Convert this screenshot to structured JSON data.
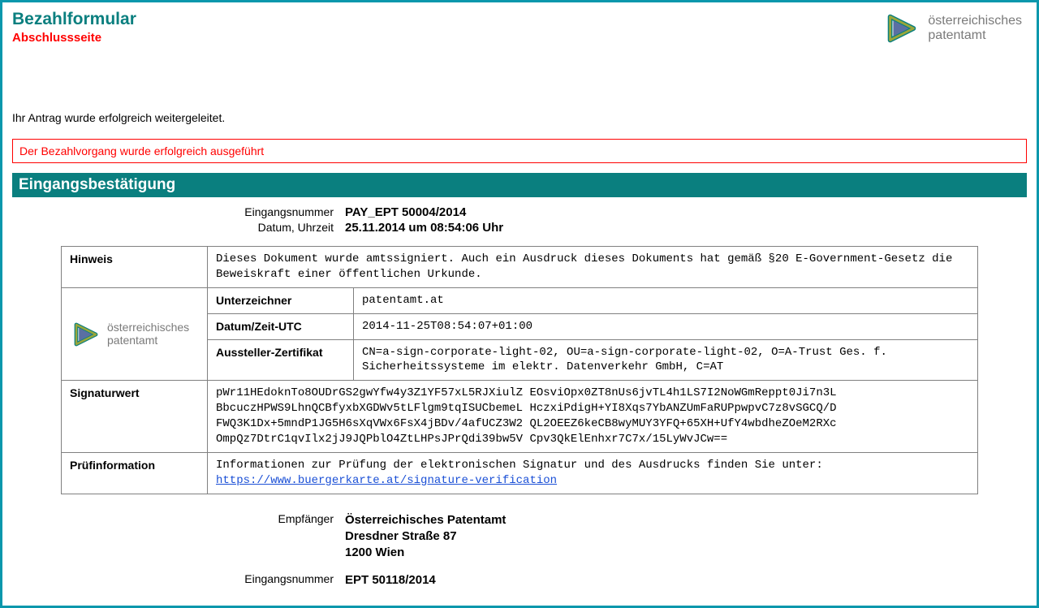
{
  "header": {
    "title": "Bezahlformular",
    "subtitle": "Abschlussseite",
    "logo_line1": "österreichisches",
    "logo_line2": "patentamt"
  },
  "forward_msg": "Ihr Antrag wurde erfolgreich weitergeleitet.",
  "pay_status": "Der Bezahlvorgang wurde erfolgreich ausgeführt",
  "confirm_section_title": "Eingangsbestätigung",
  "meta": {
    "num_label": "Eingangsnummer",
    "num_value": "PAY_EPT 50004/2014",
    "dt_label": "Datum, Uhrzeit",
    "dt_value": "25.11.2014 um 08:54:06 Uhr"
  },
  "sig": {
    "hinweis_label": "Hinweis",
    "hinweis_text": "Dieses Dokument wurde amtssigniert. Auch ein Ausdruck dieses Dokuments hat gemäß §20 E-Government-Gesetz die Beweiskraft einer öffentlichen Urkunde.",
    "small_logo_line1": "österreichisches",
    "small_logo_line2": "patentamt",
    "unterzeichner_label": "Unterzeichner",
    "unterzeichner_value": "patentamt.at",
    "datum_label": "Datum/Zeit-UTC",
    "datum_value": "2014-11-25T08:54:07+01:00",
    "aussteller_label": "Aussteller-Zertifikat",
    "aussteller_value": "CN=a-sign-corporate-light-02, OU=a-sign-corporate-light-02, O=A-Trust Ges. f. Sicherheitssysteme im elektr. Datenverkehr GmbH, C=AT",
    "signaturwert_label": "Signaturwert",
    "signaturwert_value": "pWr11HEdoknTo8OUDrGS2gwYfw4y3Z1YF57xL5RJXiulZ EOsviOpx0ZT8nUs6jvTL4h1LS7I2NoWGmReppt0Ji7n3L BbcuczHPWS9LhnQCBfyxbXGDWv5tLFlgm9tqISUCbemeL HczxiPdigH+YI8Xqs7YbANZUmFaRUPpwpvC7z8vSGCQ/D FWQ3K1Dx+5mndP1JG5H6sXqVWx6FsX4jBDv/4afUCZ3W2 QL2OEEZ6keCB8wyMUY3YFQ+65XH+UfY4wbdheZOeM2RXc OmpQz7DtrC1qvIlx2jJ9JQPblO4ZtLHPsJPrQdi39bw5V Cpv3QkElEnhxr7C7x/15LyWvJCw==",
    "pruef_label": "Prüfinformation",
    "pruef_text": "Informationen zur Prüfung der elektronischen Signatur und des Ausdrucks finden Sie unter: ",
    "pruef_link": "https://www.buergerkarte.at/signature-verification"
  },
  "recipient": {
    "label": "Empfänger",
    "name": "Österreichisches Patentamt",
    "street": "Dresdner Straße 87",
    "city": "1200 Wien",
    "num_label": "Eingangsnummer",
    "num_value": "EPT 50118/2014"
  }
}
